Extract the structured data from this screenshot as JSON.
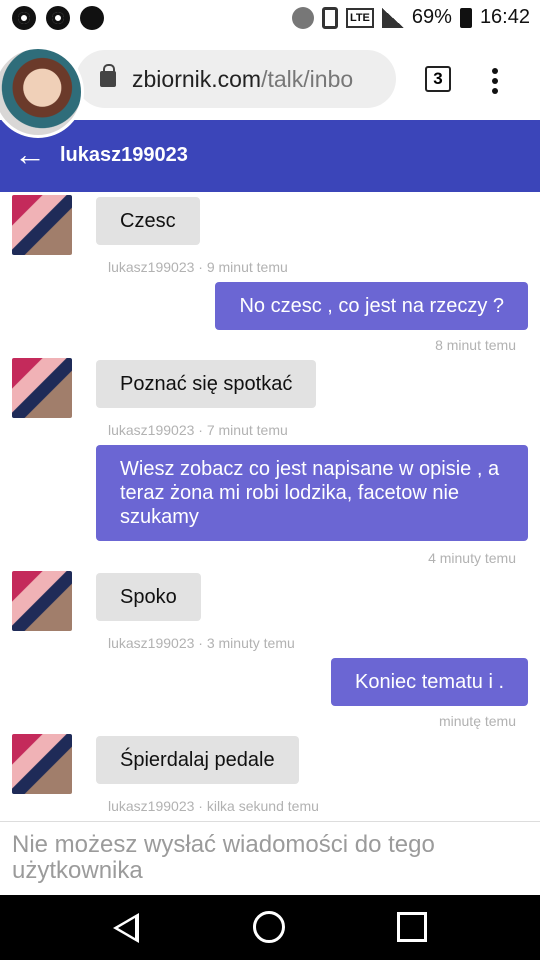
{
  "status": {
    "battery": "69%",
    "time": "16:42",
    "network_label": "LTE"
  },
  "browser": {
    "url_domain": "zbiornik.com",
    "url_path": "/talk/inbo",
    "tab_count": "3"
  },
  "chat": {
    "title": "lukasz199023",
    "messages": [
      {
        "direction": "in",
        "text": "Czesc",
        "meta": "lukasz199023 · 9 minut temu"
      },
      {
        "direction": "out",
        "text": "No czesc , co jest na rzeczy ?",
        "meta": "8 minut temu"
      },
      {
        "direction": "in",
        "text": "Poznać się spotkać",
        "meta": "lukasz199023 · 7 minut temu"
      },
      {
        "direction": "out",
        "text": "Wiesz zobacz co jest napisane w opisie , a teraz żona mi robi lodzika, facetow nie szukamy",
        "meta": "4 minuty temu"
      },
      {
        "direction": "in",
        "text": "Spoko",
        "meta": "lukasz199023 · 3 minuty temu"
      },
      {
        "direction": "out",
        "text": "Koniec tematu i .",
        "meta": "minutę temu"
      },
      {
        "direction": "in",
        "text": "Śpierdalaj pedale",
        "meta": "lukasz199023 · kilka sekund temu"
      }
    ],
    "composer_disabled_text": "Nie możesz wysłać wiadomości do tego użytkownika"
  },
  "icons": {
    "back": "back-arrow-icon",
    "lock": "lock-icon",
    "menu": "more-vert-icon"
  },
  "colors": {
    "header": "#3b45b9",
    "incoming_bubble": "#e2e2e2",
    "outgoing_bubble": "#6b66d3"
  }
}
